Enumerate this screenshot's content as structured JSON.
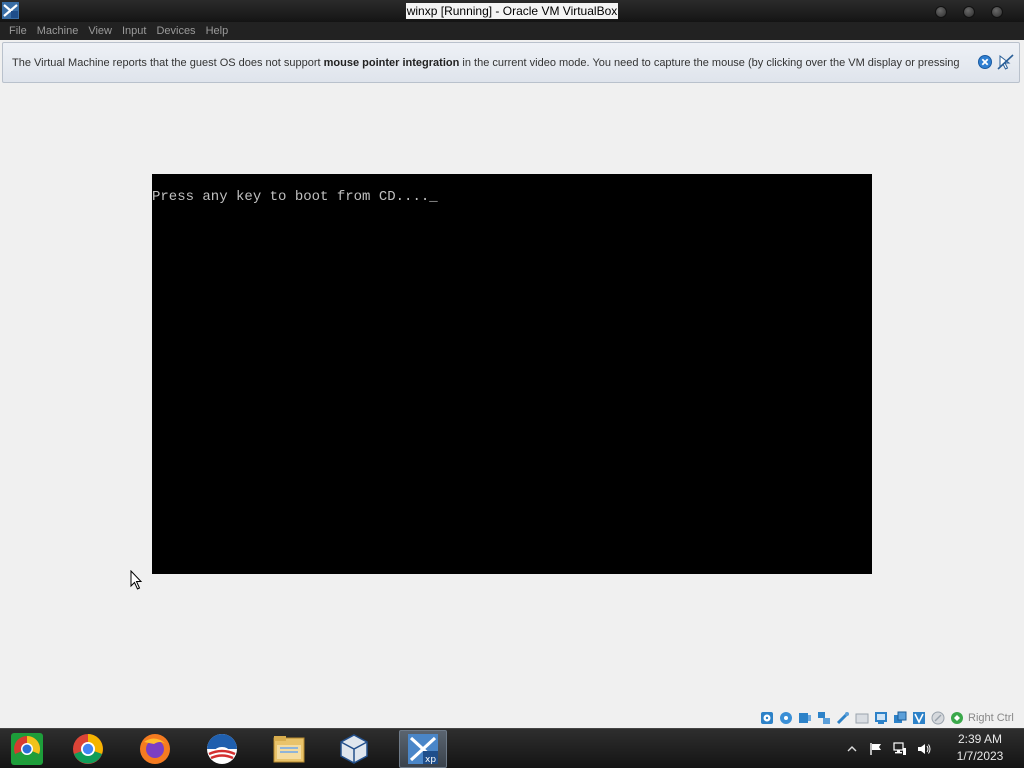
{
  "window": {
    "title": "winxp [Running] - Oracle VM VirtualBox",
    "app_icon": "virtualbox-icon",
    "controls": [
      "minimize-button",
      "maximize-button",
      "close-button"
    ]
  },
  "menu": {
    "items": [
      {
        "label": "File"
      },
      {
        "label": "Machine"
      },
      {
        "label": "View"
      },
      {
        "label": "Input"
      },
      {
        "label": "Devices"
      },
      {
        "label": "Help"
      }
    ]
  },
  "notice": {
    "text_before": "The Virtual Machine reports that the guest OS does not support ",
    "text_bold": "mouse pointer integration",
    "text_after": " in the current video mode. You need to capture the mouse (by clicking over the VM display or pressing",
    "close_icon": "close-icon",
    "disable_icon": "mouse-disable-icon"
  },
  "vm": {
    "boot_message": "Press any key to boot from CD....",
    "cursor": "_"
  },
  "statusbar": {
    "icons": [
      "hard-disk-icon",
      "optical-drive-icon",
      "audio-icon",
      "network-icon",
      "usb-icon",
      "shared-folders-icon",
      "display-icon",
      "video-capture-icon",
      "virtualization-icon",
      "mouse-integration-icon",
      "keyboard-capture-icon"
    ],
    "host_key": "Right Ctrl"
  },
  "taskbar": {
    "apps": [
      {
        "name": "chromium-icon"
      },
      {
        "name": "chrome-icon"
      },
      {
        "name": "firefox-icon"
      },
      {
        "name": "obama-logo-icon"
      },
      {
        "name": "file-explorer-icon"
      },
      {
        "name": "virtualbox-icon"
      },
      {
        "name": "winxp-vm-icon",
        "active": true
      }
    ],
    "tray_icons": [
      "show-hidden-icons",
      "flag-icon",
      "network-icon",
      "volume-icon"
    ],
    "time": "2:39 AM",
    "date": "1/7/2023"
  }
}
